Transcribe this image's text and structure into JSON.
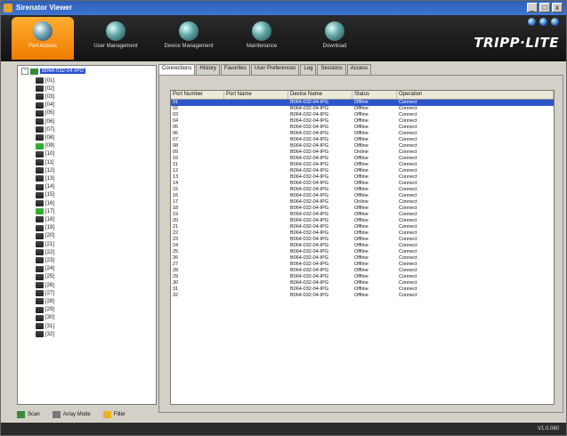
{
  "window": {
    "title": "Sirenator Viewer",
    "controls": [
      "_",
      "□",
      "x"
    ]
  },
  "nav": [
    {
      "label": "Port Access",
      "icon": "port-access-icon",
      "active": true
    },
    {
      "label": "User Management",
      "icon": "user-management-icon",
      "active": false
    },
    {
      "label": "Device Management",
      "icon": "device-management-icon",
      "active": false
    },
    {
      "label": "Maintenance",
      "icon": "maintenance-icon",
      "active": false
    },
    {
      "label": "Download",
      "icon": "download-icon",
      "active": false
    }
  ],
  "brand": "TRIPP·LITE",
  "tree": {
    "root": "B064-032-04-IPG",
    "nodes": [
      "[01]",
      "[02]",
      "[03]",
      "[04]",
      "[05]",
      "[06]",
      "[07]",
      "[08]",
      "[09]",
      "[10]",
      "[11]",
      "[12]",
      "[13]",
      "[14]",
      "[15]",
      "[16]",
      "[17]",
      "[18]",
      "[19]",
      "[20]",
      "[21]",
      "[22]",
      "[23]",
      "[24]",
      "[25]",
      "[26]",
      "[27]",
      "[28]",
      "[29]",
      "[30]",
      "[31]",
      "[32]"
    ]
  },
  "bottom": {
    "scan": "Scan",
    "array_mode": "Array Mode",
    "filter": "Filter"
  },
  "tabs": [
    "Connections",
    "History",
    "Favorites",
    "User Preferences",
    "Log",
    "Sessions",
    "Access"
  ],
  "table": {
    "columns": [
      "Port Number",
      "Port Name",
      "Device Name",
      "Status",
      "Operation"
    ],
    "rows": [
      [
        "01",
        "",
        "B064-032-04-IPG",
        "Offline",
        "Connect"
      ],
      [
        "02",
        "",
        "B064-032-04-IPG",
        "Offline",
        "Connect"
      ],
      [
        "03",
        "",
        "B064-032-04-IPG",
        "Offline",
        "Connect"
      ],
      [
        "04",
        "",
        "B064-032-04-IPG",
        "Offline",
        "Connect"
      ],
      [
        "05",
        "",
        "B064-032-04-IPG",
        "Offline",
        "Connect"
      ],
      [
        "06",
        "",
        "B064-032-04-IPG",
        "Offline",
        "Connect"
      ],
      [
        "07",
        "",
        "B064-032-04-IPG",
        "Offline",
        "Connect"
      ],
      [
        "08",
        "",
        "B064-032-04-IPG",
        "Offline",
        "Connect"
      ],
      [
        "09",
        "",
        "B064-032-04-IPG",
        "Online",
        "Connect"
      ],
      [
        "10",
        "",
        "B064-032-04-IPG",
        "Offline",
        "Connect"
      ],
      [
        "11",
        "",
        "B064-032-04-IPG",
        "Offline",
        "Connect"
      ],
      [
        "12",
        "",
        "B064-032-04-IPG",
        "Offline",
        "Connect"
      ],
      [
        "13",
        "",
        "B064-032-04-IPG",
        "Offline",
        "Connect"
      ],
      [
        "14",
        "",
        "B064-032-04-IPG",
        "Offline",
        "Connect"
      ],
      [
        "15",
        "",
        "B064-032-04-IPG",
        "Offline",
        "Connect"
      ],
      [
        "16",
        "",
        "B064-032-04-IPG",
        "Offline",
        "Connect"
      ],
      [
        "17",
        "",
        "B064-032-04-IPG",
        "Online",
        "Connect"
      ],
      [
        "18",
        "",
        "B064-032-04-IPG",
        "Offline",
        "Connect"
      ],
      [
        "19",
        "",
        "B064-032-04-IPG",
        "Offline",
        "Connect"
      ],
      [
        "20",
        "",
        "B064-032-04-IPG",
        "Offline",
        "Connect"
      ],
      [
        "21",
        "",
        "B064-032-04-IPG",
        "Offline",
        "Connect"
      ],
      [
        "22",
        "",
        "B064-032-04-IPG",
        "Offline",
        "Connect"
      ],
      [
        "23",
        "",
        "B064-032-04-IPG",
        "Offline",
        "Connect"
      ],
      [
        "24",
        "",
        "B064-032-04-IPG",
        "Offline",
        "Connect"
      ],
      [
        "25",
        "",
        "B064-032-04-IPG",
        "Offline",
        "Connect"
      ],
      [
        "26",
        "",
        "B064-032-04-IPG",
        "Offline",
        "Connect"
      ],
      [
        "27",
        "",
        "B064-032-04-IPG",
        "Offline",
        "Connect"
      ],
      [
        "28",
        "",
        "B064-032-04-IPG",
        "Offline",
        "Connect"
      ],
      [
        "29",
        "",
        "B064-032-04-IPG",
        "Offline",
        "Connect"
      ],
      [
        "30",
        "",
        "B064-032-04-IPG",
        "Offline",
        "Connect"
      ],
      [
        "31",
        "",
        "B064-032-04-IPG",
        "Offline",
        "Connect"
      ],
      [
        "32",
        "",
        "B064-032-04-IPG",
        "Offline",
        "Connect"
      ]
    ],
    "selected_index": 0
  },
  "status": {
    "version": "V1.0.060"
  }
}
